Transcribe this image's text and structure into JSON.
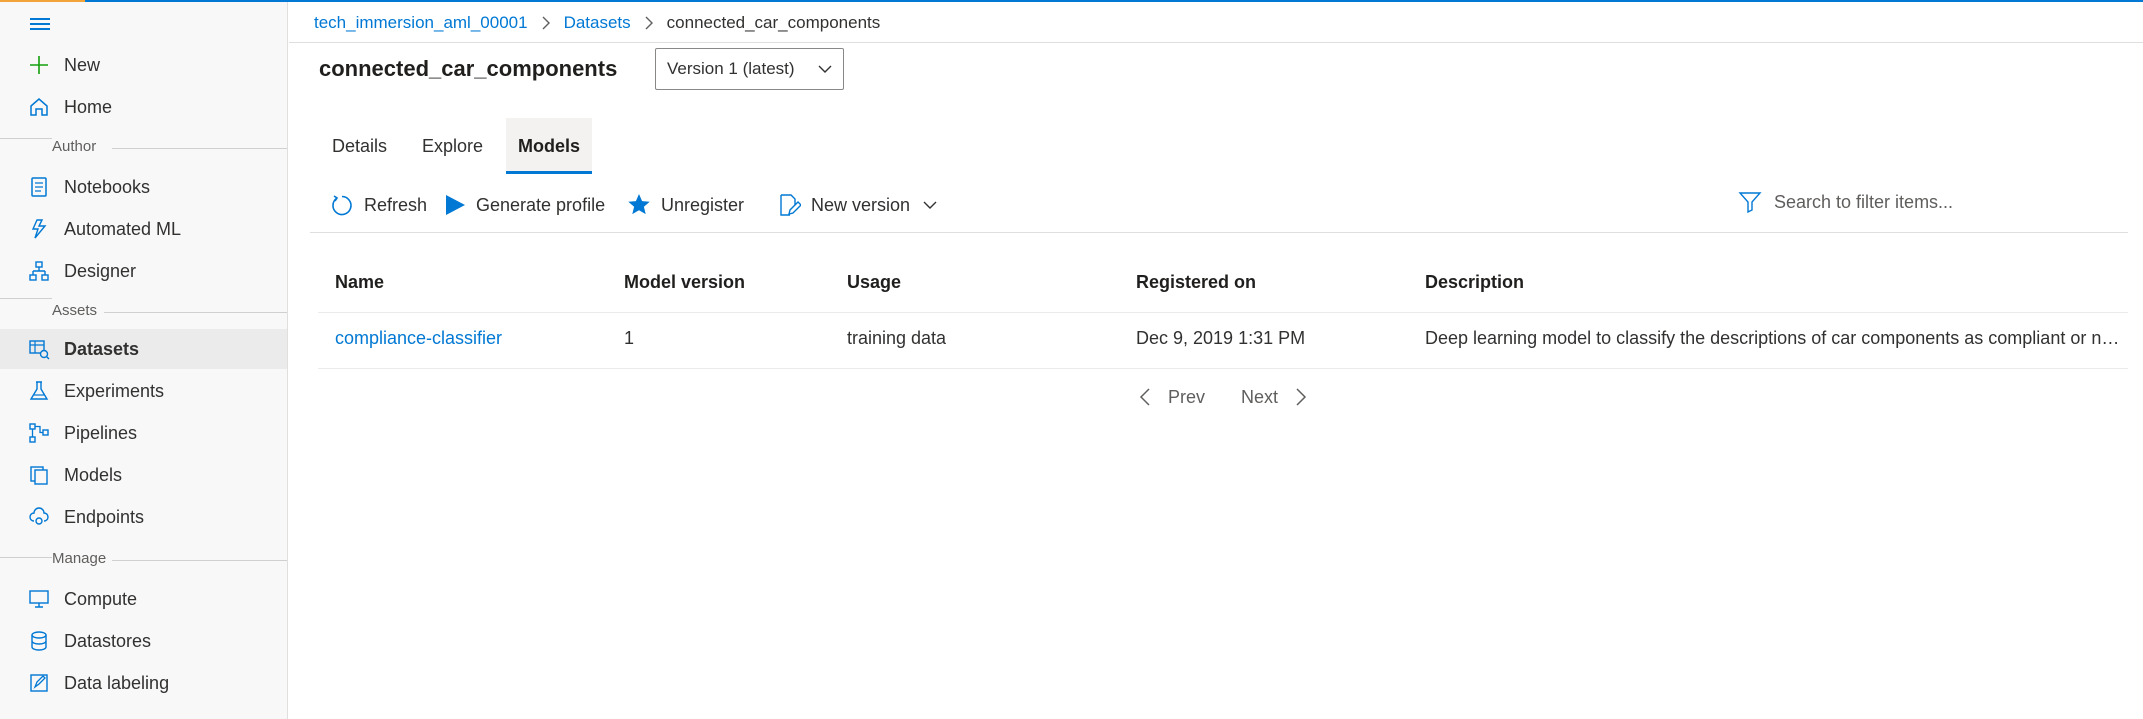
{
  "sidebar": {
    "items": [
      {
        "label": "New",
        "icon": "plus-icon"
      },
      {
        "label": "Home",
        "icon": "home-icon"
      },
      {
        "label": "Notebooks",
        "icon": "notebook-icon"
      },
      {
        "label": "Automated ML",
        "icon": "automated-ml-icon"
      },
      {
        "label": "Designer",
        "icon": "designer-icon"
      },
      {
        "label": "Datasets",
        "icon": "datasets-icon",
        "active": true
      },
      {
        "label": "Experiments",
        "icon": "flask-icon"
      },
      {
        "label": "Pipelines",
        "icon": "pipeline-icon"
      },
      {
        "label": "Models",
        "icon": "models-icon"
      },
      {
        "label": "Endpoints",
        "icon": "endpoints-icon"
      },
      {
        "label": "Compute",
        "icon": "compute-icon"
      },
      {
        "label": "Datastores",
        "icon": "datastore-icon"
      },
      {
        "label": "Data labeling",
        "icon": "data-labeling-icon"
      }
    ],
    "sections": {
      "author": "Author",
      "assets": "Assets",
      "manage": "Manage"
    }
  },
  "breadcrumb": {
    "workspace": "tech_immersion_aml_00001",
    "datasets": "Datasets",
    "current": "connected_car_components"
  },
  "page": {
    "title": "connected_car_components",
    "version": "Version 1 (latest)"
  },
  "tabs": [
    {
      "label": "Details"
    },
    {
      "label": "Explore"
    },
    {
      "label": "Models",
      "active": true
    }
  ],
  "toolbar": {
    "refresh": "Refresh",
    "generate_profile": "Generate profile",
    "unregister": "Unregister",
    "new_version": "New version",
    "search_placeholder": "Search to filter items..."
  },
  "table": {
    "columns": [
      "Name",
      "Model version",
      "Usage",
      "Registered on",
      "Description"
    ],
    "rows": [
      {
        "name": "compliance-classifier",
        "model_version": "1",
        "usage": "training data",
        "registered_on": "Dec 9, 2019 1:31 PM",
        "description": "Deep learning model to classify the descriptions of car components as compliant or non-compliant."
      }
    ]
  },
  "pagination": {
    "prev": "Prev",
    "next": "Next"
  },
  "colors": {
    "accent": "#0078d4",
    "text": "#323130",
    "sidebar_bg": "#f8f8f8"
  }
}
